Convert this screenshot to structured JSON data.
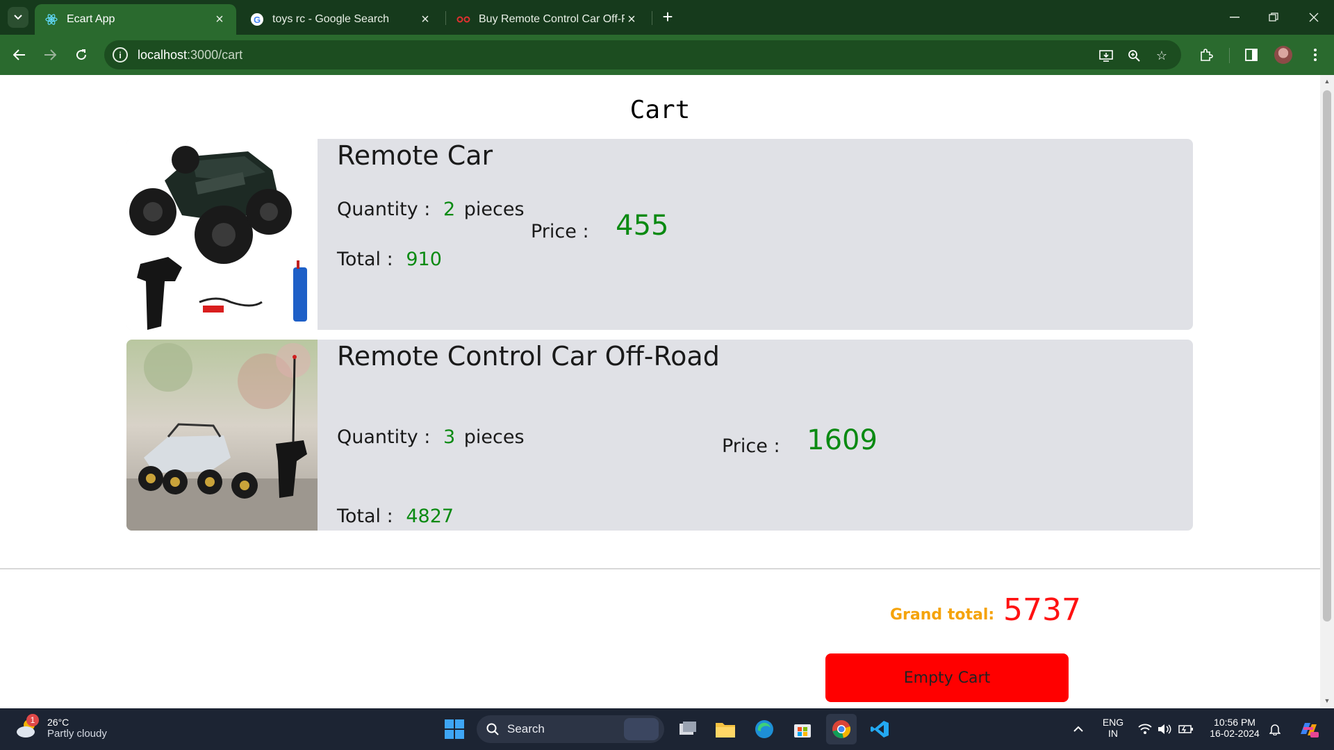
{
  "browser": {
    "tabs": [
      {
        "title": "Ecart App",
        "active": true,
        "icon": "react-icon"
      },
      {
        "title": "toys rc - Google Search",
        "active": false,
        "icon": "google-icon"
      },
      {
        "title": "Buy Remote Control Car Off-Ro",
        "active": false,
        "icon": "store-icon"
      }
    ],
    "url_host": "localhost",
    "url_path": ":3000/cart"
  },
  "page": {
    "title": "Cart",
    "items": [
      {
        "name": "Remote Car",
        "quantity_label": "Quantity :",
        "quantity": "2",
        "unit": "pieces",
        "price_label": "Price :",
        "price": "455",
        "total_label": "Total :",
        "total": "910"
      },
      {
        "name": "Remote Control Car Off-Road",
        "quantity_label": "Quantity :",
        "quantity": "3",
        "unit": "pieces",
        "price_label": "Price :",
        "price": "1609",
        "total_label": "Total :",
        "total": "4827"
      }
    ],
    "grand_total_label": "Grand total:",
    "grand_total": "5737",
    "empty_cart_label": "Empty Cart"
  },
  "taskbar": {
    "weather_temp": "26°C",
    "weather_condition": "Partly cloudy",
    "weather_badge": "1",
    "search_label": "Search",
    "lang_line1": "ENG",
    "lang_line2": "IN",
    "time": "10:56 PM",
    "date": "16-02-2024"
  },
  "colors": {
    "tab_bar": "#163a1c",
    "toolbar": "#2a6a2e",
    "item_bg": "#e0e1e6",
    "value_green": "#0a8a12",
    "grand_label": "#f5a30a",
    "grand_value": "#ff1111",
    "empty_button": "#ff0000"
  }
}
